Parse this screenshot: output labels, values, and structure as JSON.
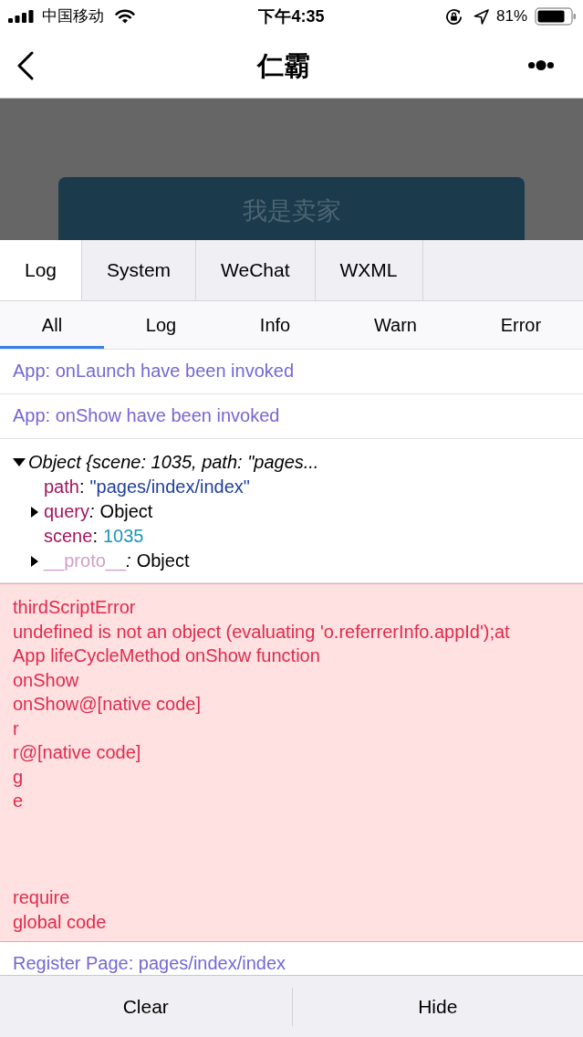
{
  "status_bar": {
    "carrier": "中国移动",
    "time": "下午4:35",
    "battery": "81%"
  },
  "nav_bar": {
    "title": "仁霸"
  },
  "page": {
    "button": "我是卖家"
  },
  "tabs": [
    {
      "label": "Log",
      "selected": true
    },
    {
      "label": "System",
      "selected": false
    },
    {
      "label": "WeChat",
      "selected": false
    },
    {
      "label": "WXML",
      "selected": false
    }
  ],
  "filters": [
    {
      "label": "All",
      "selected": true
    },
    {
      "label": "Log",
      "selected": false
    },
    {
      "label": "Info",
      "selected": false
    },
    {
      "label": "Warn",
      "selected": false
    },
    {
      "label": "Error",
      "selected": false
    }
  ],
  "logs": [
    {
      "kind": "info",
      "text": "App: onLaunch have been invoked"
    },
    {
      "kind": "info",
      "text": "App: onShow have been invoked"
    },
    {
      "kind": "object",
      "summary": "Object {scene: 1035, path: \"pages...",
      "expanded": true,
      "children": [
        {
          "kind": "string",
          "key": "path",
          "separator": ":",
          "value": "\"pages/index/index\""
        },
        {
          "kind": "object",
          "key": "query",
          "separator": ":",
          "value": "Object",
          "expanded": false
        },
        {
          "kind": "number",
          "key": "scene",
          "separator": ":",
          "value": "1035"
        },
        {
          "kind": "proto",
          "key": "__proto__",
          "separator": ":",
          "value": "Object",
          "expanded": false
        }
      ]
    },
    {
      "kind": "error",
      "lines": [
        "thirdScriptError",
        "undefined is not an object (evaluating 'o.referrerInfo.appId');at",
        "App lifeCycleMethod onShow function",
        "onShow",
        "onShow@[native code]",
        "r",
        "r@[native code]",
        "g",
        "e"
      ],
      "trailing_lines": [
        "require",
        "global code"
      ]
    },
    {
      "kind": "info",
      "text": "Register Page: pages/index/index"
    }
  ],
  "bottom_bar": {
    "buttons": [
      "Clear",
      "Hide"
    ]
  }
}
